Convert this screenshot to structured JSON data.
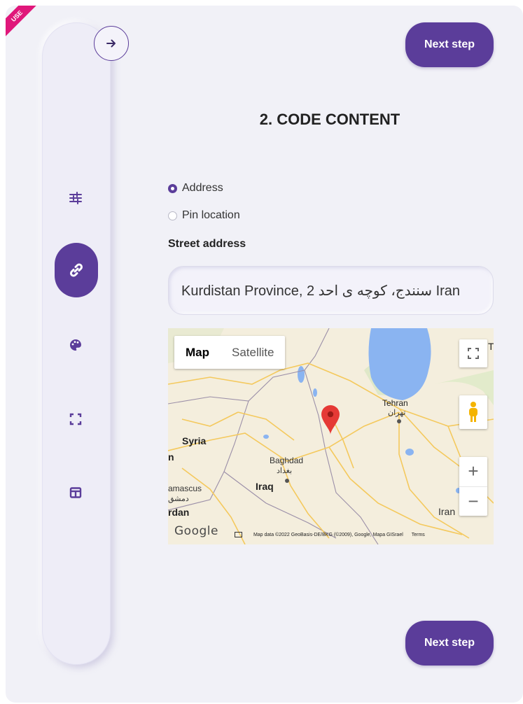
{
  "badge": {
    "text": "USE"
  },
  "top_button": {
    "label": "Next step"
  },
  "bottom_button": {
    "label": "Next step"
  },
  "section": {
    "title": "2. CODE CONTENT"
  },
  "location_mode": {
    "options": [
      {
        "label": "Address",
        "selected": true
      },
      {
        "label": "Pin location",
        "selected": false
      }
    ]
  },
  "street_address": {
    "label": "Street address",
    "value": "Kurdistan Province, 2 سنندج، کوچه ی احد Iran"
  },
  "map": {
    "map_type_options": [
      "Map",
      "Satellite"
    ],
    "selected_map_type": "Map",
    "labels": {
      "tehran": "Tehran",
      "tehran_local": "تهران",
      "syria": "Syria",
      "baghdad": "Baghdad",
      "baghdad_local": "بغداد",
      "iraq": "Iraq",
      "damascus": "amascus",
      "damascus_local": "دمشق",
      "jordan": "rdan",
      "iran": "Iran",
      "edge_n": "n",
      "edge_t": "T"
    },
    "zoom_in": "+",
    "zoom_out": "−",
    "logo": "Google",
    "attribution": "Map data ©2022 GeoBasis-DE/BKG (©2009), Google, Mapa GISrael",
    "terms": "Terms"
  },
  "colors": {
    "accent": "#5b3d9a",
    "badge": "#e0177a",
    "panel_bg": "#f1f1f7",
    "marker": "#e53935"
  },
  "rail_icons": [
    "sliders-icon",
    "link-icon",
    "palette-icon",
    "frame-icon",
    "layout-icon"
  ]
}
